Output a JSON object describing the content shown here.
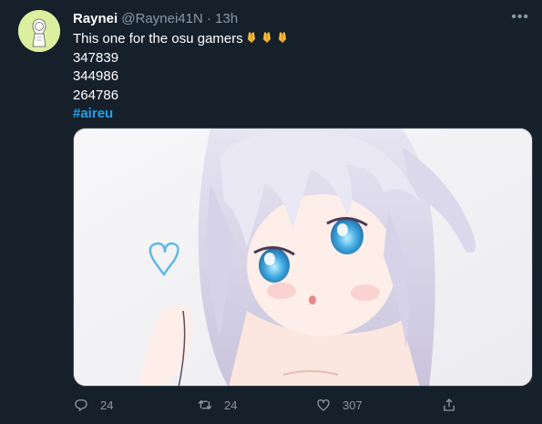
{
  "author": {
    "display_name": "Raynei",
    "handle": "@Raynei41N",
    "separator": "·",
    "time": "13h"
  },
  "more_label": "•••",
  "tweet": {
    "text": "This one for the osu gamers",
    "emojis": [
      "folded-hands",
      "folded-hands",
      "folded-hands"
    ],
    "numbers": [
      "347839",
      "344986",
      "264786"
    ],
    "hashtag": "#aireu"
  },
  "media": {
    "alt_subject": "anime girl with long white hair and blue eyes, blue heart doodle",
    "colors": {
      "hair": "#dcd8ec",
      "eyes": "#3fa9e0",
      "heart": "#5cb8e6",
      "background": "#f4f4f6"
    }
  },
  "actions": {
    "reply_count": "24",
    "retweet_count": "24",
    "like_count": "307"
  },
  "colors": {
    "background": "#15202b",
    "text": "#ffffff",
    "secondary": "#8899a6",
    "accent": "#1da1f2",
    "border": "#38444d"
  }
}
